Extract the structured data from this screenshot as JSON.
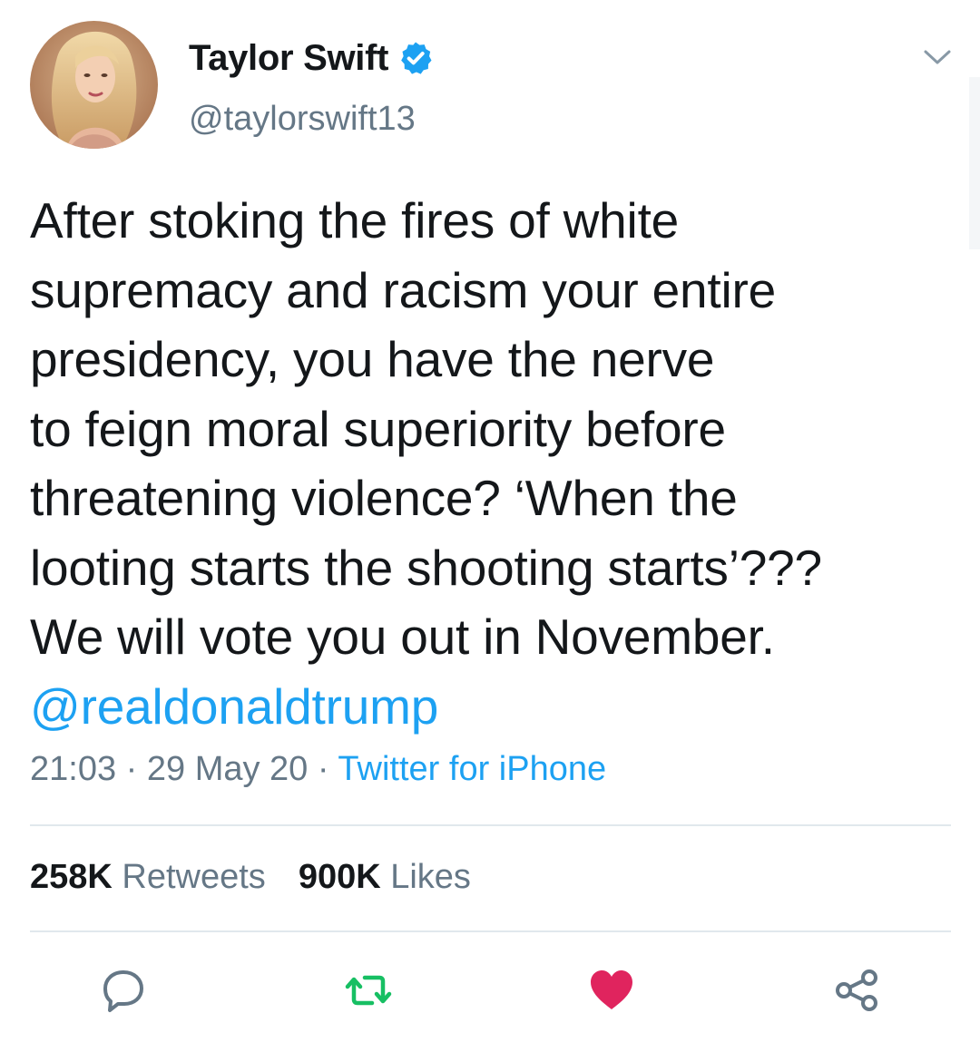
{
  "user": {
    "display_name": "Taylor Swift",
    "handle": "@taylorswift13",
    "verified": true
  },
  "tweet": {
    "lines": [
      "After stoking the fires of white",
      "supremacy and racism your entire",
      "presidency, you have the nerve",
      "to feign moral superiority before",
      "threatening violence? ‘When the",
      "looting starts the shooting starts’???",
      "We will vote you out in November."
    ],
    "mention": "@realdonaldtrump"
  },
  "meta": {
    "time": "21:03",
    "separator": " · ",
    "date": "29 May 20",
    "source": "Twitter for iPhone"
  },
  "stats": {
    "retweets_count": "258K",
    "retweets_label": "Retweets",
    "likes_count": "900K",
    "likes_label": "Likes"
  },
  "icons": {
    "avatar": "avatar-photo",
    "verified": "verified-badge-icon",
    "menu": "chevron-down-icon",
    "reply": "reply-icon",
    "retweet": "retweet-icon",
    "like": "heart-icon",
    "share": "share-icon"
  },
  "colors": {
    "text": "#14171a",
    "secondary": "#657786",
    "link": "#1da1f2",
    "retweet": "#17bf63",
    "like": "#e0245e",
    "divider": "#e1e8ed"
  }
}
